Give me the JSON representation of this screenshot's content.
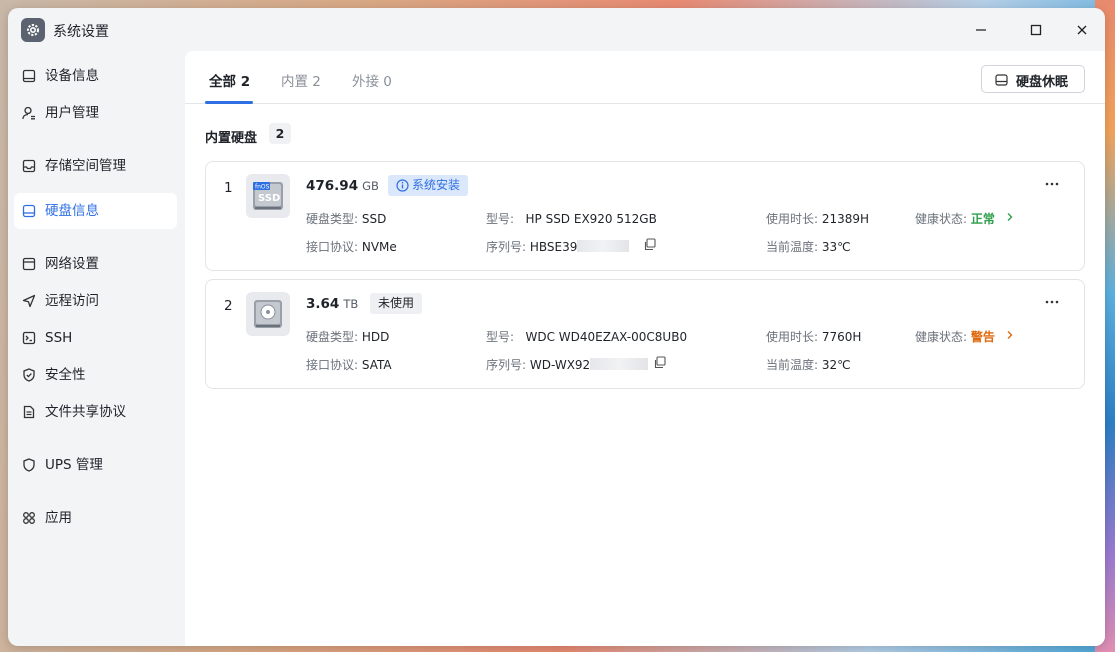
{
  "window": {
    "title": "系统设置",
    "icon": "gear-icon"
  },
  "sidebar": {
    "items": [
      {
        "label": "设备信息",
        "icon": "device-icon"
      },
      {
        "label": "用户管理",
        "icon": "user-icon"
      },
      {
        "label": "存储空间管理",
        "icon": "storage-icon"
      },
      {
        "label": "硬盘信息",
        "icon": "disk-icon",
        "active": true
      },
      {
        "label": "网络设置",
        "icon": "network-icon"
      },
      {
        "label": "远程访问",
        "icon": "send-icon"
      },
      {
        "label": "SSH",
        "icon": "terminal-icon"
      },
      {
        "label": "安全性",
        "icon": "shield-check-icon"
      },
      {
        "label": "文件共享协议",
        "icon": "file-icon"
      },
      {
        "label": "UPS 管理",
        "icon": "shield-icon"
      },
      {
        "label": "应用",
        "icon": "apps-icon"
      }
    ]
  },
  "tabs": [
    {
      "label": "全部 2",
      "active": true
    },
    {
      "label": "内置 2"
    },
    {
      "label": "外接 0"
    }
  ],
  "toolbar": {
    "sleep_label": "硬盘休眠"
  },
  "section": {
    "title": "内置硬盘",
    "count": "2"
  },
  "disks": [
    {
      "index": "1",
      "image_label": "fnOS SSD",
      "capacity": "476.94",
      "unit": "GB",
      "badge": "系统安装",
      "type_label": "硬盘类型:",
      "type": "SSD",
      "model_label": "型号:",
      "model": "HP SSD EX920 512GB",
      "hours_label": "使用时长:",
      "hours": "21389H",
      "health_label": "健康状态:",
      "health": "正常",
      "iface_label": "接口协议:",
      "iface": "NVMe",
      "serial_label": "序列号:",
      "serial": "HBSE39",
      "temp_label": "当前温度:",
      "temp": "33℃"
    },
    {
      "index": "2",
      "capacity": "3.64",
      "unit": "TB",
      "badge": "未使用",
      "type_label": "硬盘类型:",
      "type": "HDD",
      "model_label": "型号:",
      "model": "WDC WD40EZAX-00C8UB0",
      "hours_label": "使用时长:",
      "hours": "7760H",
      "health_label": "健康状态:",
      "health": "警告",
      "iface_label": "接口协议:",
      "iface": "SATA",
      "serial_label": "序列号:",
      "serial": "WD-WX92",
      "temp_label": "当前温度:",
      "temp": "32℃"
    }
  ],
  "colors": {
    "accent": "#2f6fe4",
    "ok": "#2e9e4a",
    "warn": "#e06a10"
  }
}
